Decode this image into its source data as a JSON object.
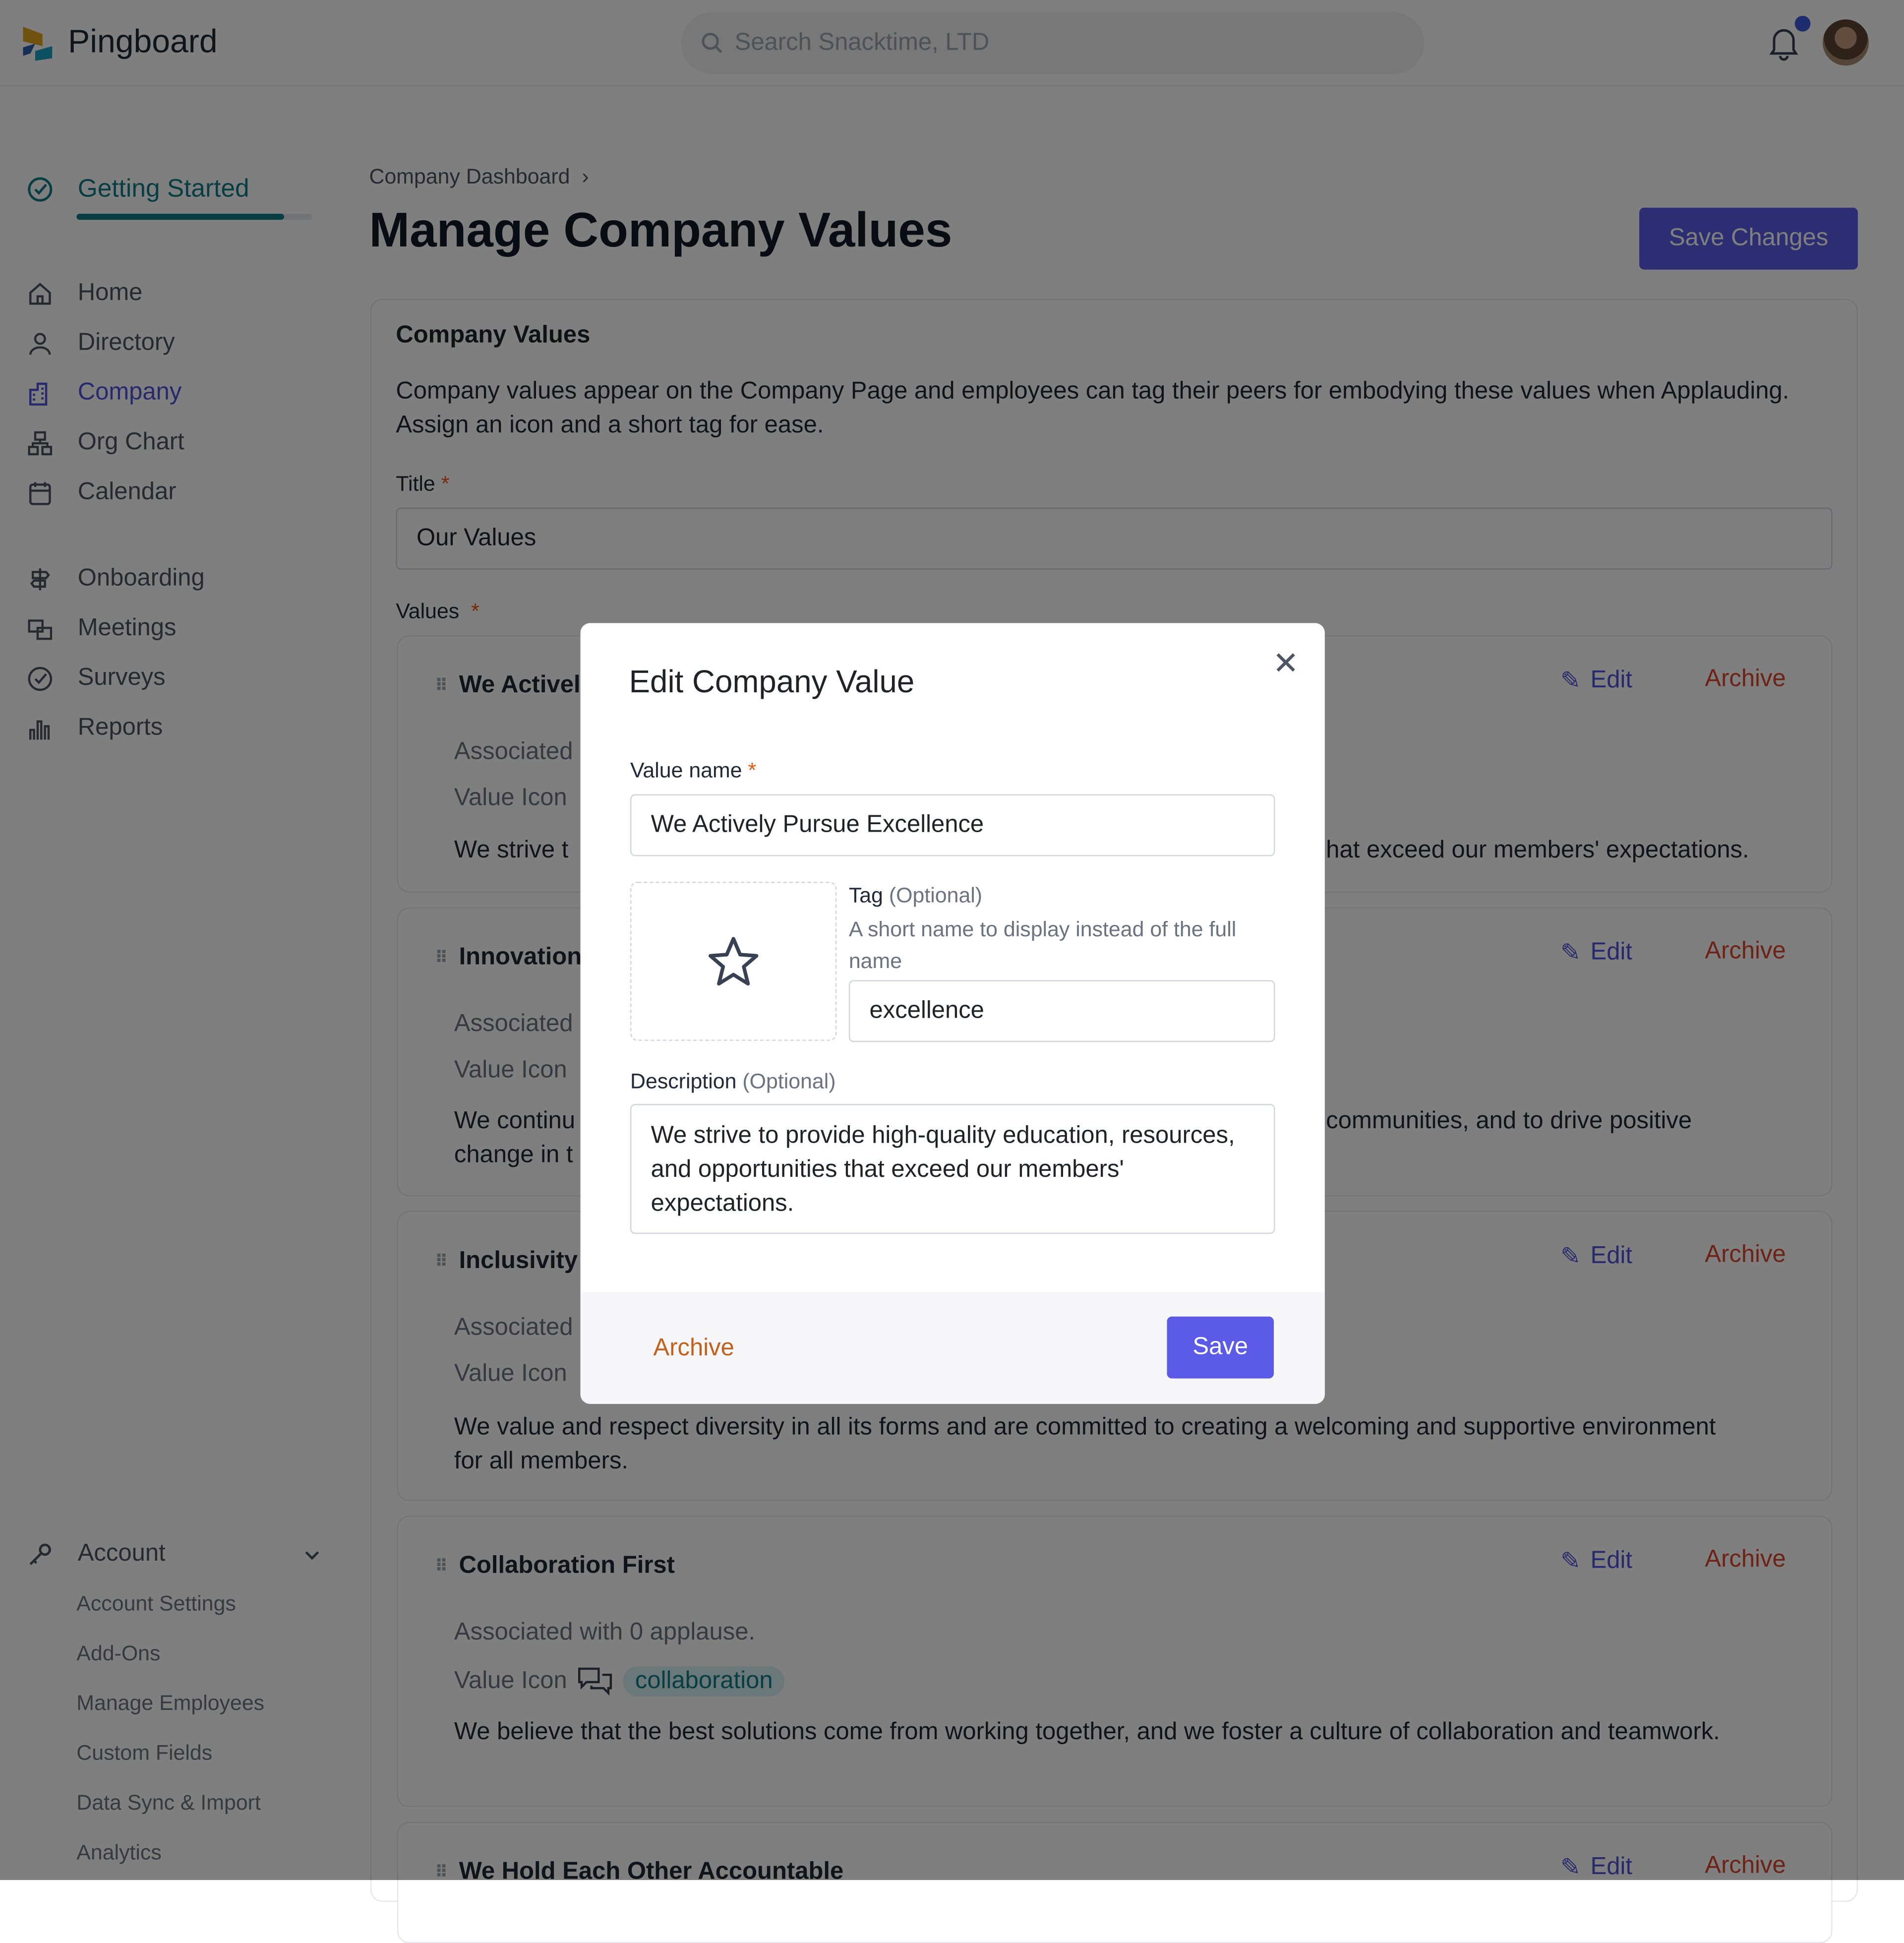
{
  "app": {
    "name": "Pingboard",
    "search_placeholder": "Search Snacktime, LTD"
  },
  "sidebar": {
    "getting_started": {
      "label": "Getting Started",
      "progress_percent": 88
    },
    "items": [
      {
        "label": "Home",
        "icon": "home-icon"
      },
      {
        "label": "Directory",
        "icon": "person-icon"
      },
      {
        "label": "Company",
        "icon": "building-icon",
        "active": true
      },
      {
        "label": "Org Chart",
        "icon": "org-chart-icon"
      },
      {
        "label": "Calendar",
        "icon": "calendar-icon"
      },
      {
        "label": "Onboarding",
        "icon": "signpost-icon"
      },
      {
        "label": "Meetings",
        "icon": "meetings-icon"
      },
      {
        "label": "Surveys",
        "icon": "check-circle-icon"
      },
      {
        "label": "Reports",
        "icon": "bar-chart-icon"
      }
    ],
    "account": {
      "label": "Account",
      "items": [
        "Account Settings",
        "Add-Ons",
        "Manage Employees",
        "Custom Fields",
        "Data Sync & Import",
        "Analytics"
      ]
    }
  },
  "page": {
    "breadcrumb": "Company Dashboard",
    "title": "Manage Company Values",
    "save_changes": "Save Changes",
    "section_title": "Company Values",
    "intro": "Company values appear on the Company Page and employees can tag their peers for embodying these values when Applauding. Assign an icon and a short tag for ease.",
    "title_label": "Title",
    "title_value": "Our Values",
    "values_label": "Values",
    "edit_label": "Edit",
    "archive_label": "Archive",
    "value_icon_label": "Value Icon",
    "cards": [
      {
        "title": "We Activel",
        "assoc": "Associated",
        "desc_left": "We strive t",
        "desc_right": "hat exceed our members' expectations."
      },
      {
        "title": "Innovation",
        "assoc": "Associated",
        "desc_left": "We continu",
        "desc_left2": "change in t",
        "desc_right": "communities, and to drive positive"
      },
      {
        "title": "Inclusivity",
        "assoc": "Associated",
        "desc": "We value and respect diversity in all its forms and are committed to creating a welcoming and supportive environment for all members."
      },
      {
        "title": "Collaboration First",
        "assoc": "Associated with 0 applause.",
        "icon": "chat-bubbles-icon",
        "tag": "collaboration",
        "desc": "We believe that the best solutions come from working together, and we foster a culture of collaboration and teamwork."
      },
      {
        "title": "We Hold Each Other Accountable"
      }
    ]
  },
  "modal": {
    "title": "Edit Company Value",
    "value_name_label": "Value name",
    "value_name": "We Actively Pursue Excellence",
    "icon": "star-icon",
    "tag_label": "Tag",
    "optional": "(Optional)",
    "tag_help": "A short name to display instead of the full name",
    "tag_value": "excellence",
    "description_label": "Description",
    "description": "We strive to provide high-quality education, resources, and opportunities that exceed our members' expectations.",
    "archive": "Archive",
    "save": "Save"
  },
  "colors": {
    "accent": "#5b5be8",
    "teal": "#0e7c86",
    "archive": "#d9472b",
    "modal_archive": "#c2611c"
  }
}
